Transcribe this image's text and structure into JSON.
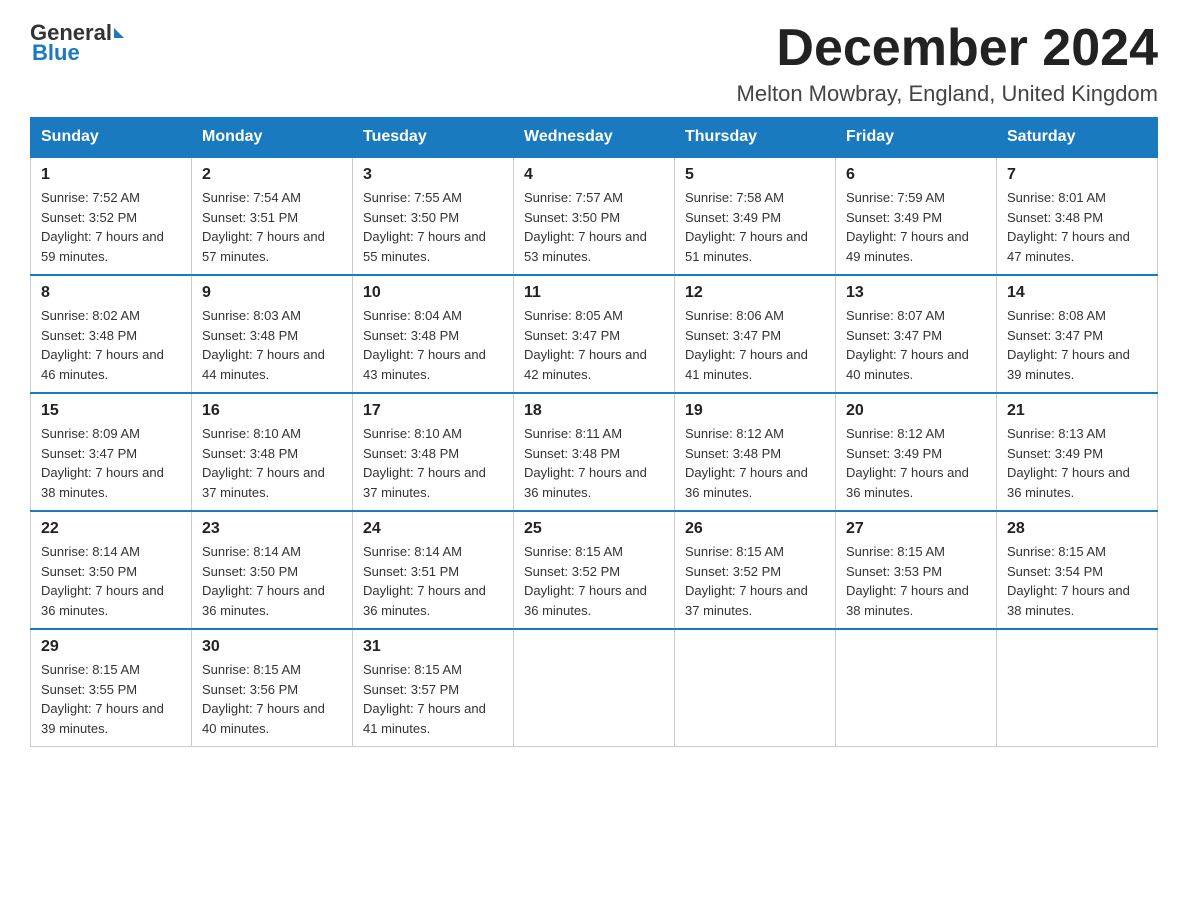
{
  "header": {
    "logo_general": "General",
    "logo_blue": "Blue",
    "month_title": "December 2024",
    "location": "Melton Mowbray, England, United Kingdom"
  },
  "days_of_week": [
    "Sunday",
    "Monday",
    "Tuesday",
    "Wednesday",
    "Thursday",
    "Friday",
    "Saturday"
  ],
  "weeks": [
    [
      {
        "day": "1",
        "sunrise": "7:52 AM",
        "sunset": "3:52 PM",
        "daylight": "7 hours and 59 minutes."
      },
      {
        "day": "2",
        "sunrise": "7:54 AM",
        "sunset": "3:51 PM",
        "daylight": "7 hours and 57 minutes."
      },
      {
        "day": "3",
        "sunrise": "7:55 AM",
        "sunset": "3:50 PM",
        "daylight": "7 hours and 55 minutes."
      },
      {
        "day": "4",
        "sunrise": "7:57 AM",
        "sunset": "3:50 PM",
        "daylight": "7 hours and 53 minutes."
      },
      {
        "day": "5",
        "sunrise": "7:58 AM",
        "sunset": "3:49 PM",
        "daylight": "7 hours and 51 minutes."
      },
      {
        "day": "6",
        "sunrise": "7:59 AM",
        "sunset": "3:49 PM",
        "daylight": "7 hours and 49 minutes."
      },
      {
        "day": "7",
        "sunrise": "8:01 AM",
        "sunset": "3:48 PM",
        "daylight": "7 hours and 47 minutes."
      }
    ],
    [
      {
        "day": "8",
        "sunrise": "8:02 AM",
        "sunset": "3:48 PM",
        "daylight": "7 hours and 46 minutes."
      },
      {
        "day": "9",
        "sunrise": "8:03 AM",
        "sunset": "3:48 PM",
        "daylight": "7 hours and 44 minutes."
      },
      {
        "day": "10",
        "sunrise": "8:04 AM",
        "sunset": "3:48 PM",
        "daylight": "7 hours and 43 minutes."
      },
      {
        "day": "11",
        "sunrise": "8:05 AM",
        "sunset": "3:47 PM",
        "daylight": "7 hours and 42 minutes."
      },
      {
        "day": "12",
        "sunrise": "8:06 AM",
        "sunset": "3:47 PM",
        "daylight": "7 hours and 41 minutes."
      },
      {
        "day": "13",
        "sunrise": "8:07 AM",
        "sunset": "3:47 PM",
        "daylight": "7 hours and 40 minutes."
      },
      {
        "day": "14",
        "sunrise": "8:08 AM",
        "sunset": "3:47 PM",
        "daylight": "7 hours and 39 minutes."
      }
    ],
    [
      {
        "day": "15",
        "sunrise": "8:09 AM",
        "sunset": "3:47 PM",
        "daylight": "7 hours and 38 minutes."
      },
      {
        "day": "16",
        "sunrise": "8:10 AM",
        "sunset": "3:48 PM",
        "daylight": "7 hours and 37 minutes."
      },
      {
        "day": "17",
        "sunrise": "8:10 AM",
        "sunset": "3:48 PM",
        "daylight": "7 hours and 37 minutes."
      },
      {
        "day": "18",
        "sunrise": "8:11 AM",
        "sunset": "3:48 PM",
        "daylight": "7 hours and 36 minutes."
      },
      {
        "day": "19",
        "sunrise": "8:12 AM",
        "sunset": "3:48 PM",
        "daylight": "7 hours and 36 minutes."
      },
      {
        "day": "20",
        "sunrise": "8:12 AM",
        "sunset": "3:49 PM",
        "daylight": "7 hours and 36 minutes."
      },
      {
        "day": "21",
        "sunrise": "8:13 AM",
        "sunset": "3:49 PM",
        "daylight": "7 hours and 36 minutes."
      }
    ],
    [
      {
        "day": "22",
        "sunrise": "8:14 AM",
        "sunset": "3:50 PM",
        "daylight": "7 hours and 36 minutes."
      },
      {
        "day": "23",
        "sunrise": "8:14 AM",
        "sunset": "3:50 PM",
        "daylight": "7 hours and 36 minutes."
      },
      {
        "day": "24",
        "sunrise": "8:14 AM",
        "sunset": "3:51 PM",
        "daylight": "7 hours and 36 minutes."
      },
      {
        "day": "25",
        "sunrise": "8:15 AM",
        "sunset": "3:52 PM",
        "daylight": "7 hours and 36 minutes."
      },
      {
        "day": "26",
        "sunrise": "8:15 AM",
        "sunset": "3:52 PM",
        "daylight": "7 hours and 37 minutes."
      },
      {
        "day": "27",
        "sunrise": "8:15 AM",
        "sunset": "3:53 PM",
        "daylight": "7 hours and 38 minutes."
      },
      {
        "day": "28",
        "sunrise": "8:15 AM",
        "sunset": "3:54 PM",
        "daylight": "7 hours and 38 minutes."
      }
    ],
    [
      {
        "day": "29",
        "sunrise": "8:15 AM",
        "sunset": "3:55 PM",
        "daylight": "7 hours and 39 minutes."
      },
      {
        "day": "30",
        "sunrise": "8:15 AM",
        "sunset": "3:56 PM",
        "daylight": "7 hours and 40 minutes."
      },
      {
        "day": "31",
        "sunrise": "8:15 AM",
        "sunset": "3:57 PM",
        "daylight": "7 hours and 41 minutes."
      },
      null,
      null,
      null,
      null
    ]
  ]
}
